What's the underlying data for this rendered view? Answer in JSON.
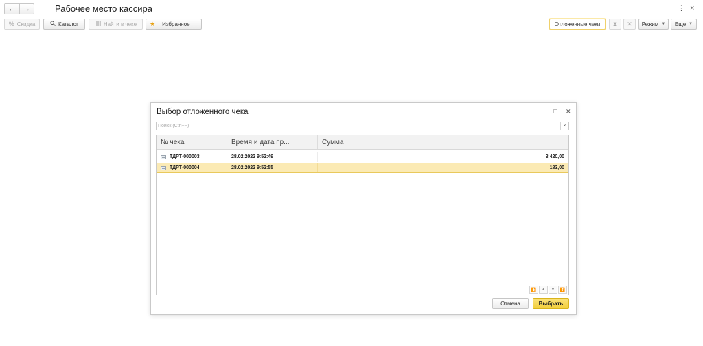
{
  "window": {
    "title": "Рабочее место кассира",
    "nav": {
      "back_icon": "←",
      "forward_icon": "→"
    },
    "more_icon": "⋮",
    "close_icon": "×"
  },
  "toolbar": {
    "discount_label": "Скидка",
    "catalog_label": "Каталог",
    "find_in_receipt_label": "Найти в чеке",
    "favorites_label": "Избранное",
    "deferred_receipts_label": "Отложенные чеки",
    "mode_label": "Режим",
    "more_label": "Еще"
  },
  "dialog": {
    "title": "Выбор отложенного чека",
    "search": {
      "placeholder": "Поиск (Ctrl+F)",
      "value": "",
      "clear_icon": "×"
    },
    "columns": [
      "№ чека",
      "Время и дата пр...",
      "Сумма"
    ],
    "sort_indicator": "↓",
    "rows": [
      {
        "number": "ТДРТ-000003",
        "datetime": "28.02.2022 9:52:49",
        "amount": "3 420,00",
        "selected": false
      },
      {
        "number": "ТДРТ-000004",
        "datetime": "28.02.2022 9:52:55",
        "amount": "183,00",
        "selected": true
      }
    ],
    "cancel_label": "Отмена",
    "select_label": "Выбрать"
  },
  "colors": {
    "selection_bg": "#fbeab4",
    "primary_button": "#f2cf3c",
    "highlight_border": "#f0d16b"
  }
}
